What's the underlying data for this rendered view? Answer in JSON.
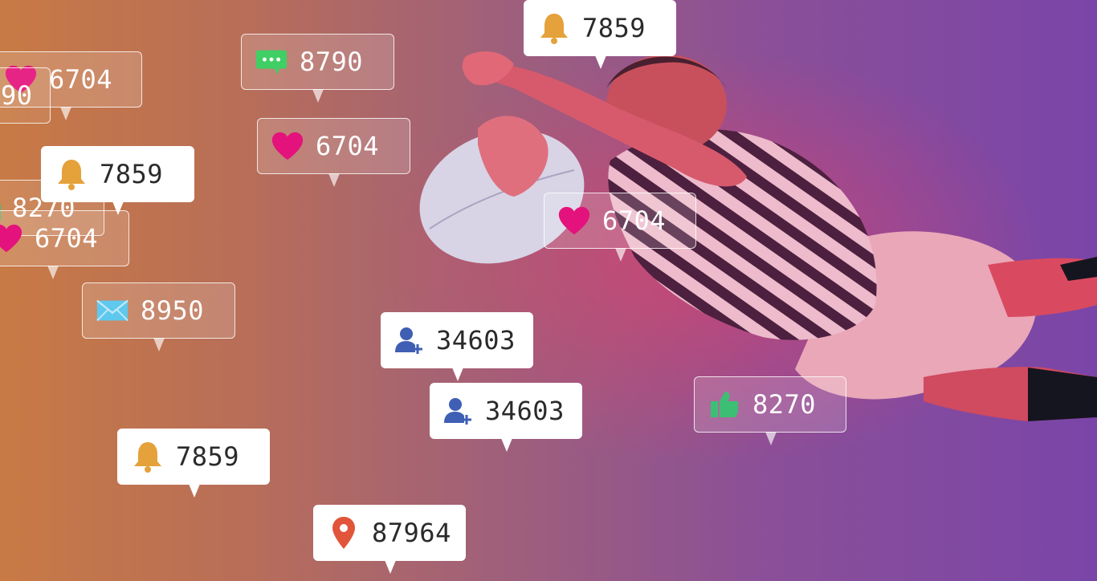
{
  "colors": {
    "heart": "#e4127c",
    "bell": "#e5a13a",
    "comment": "#3fcf65",
    "mail": "#5ec8ee",
    "user": "#3f5fb4",
    "pin": "#e1553a",
    "thumb": "#3cbf74"
  },
  "notifications": [
    {
      "icon": "bell-icon",
      "count": "7859"
    },
    {
      "icon": "comment-icon",
      "count": "8790"
    },
    {
      "icon": "heart-icon",
      "count": "6704"
    },
    {
      "icon": "heart-icon",
      "count": "6704"
    },
    {
      "icon": "bell-icon",
      "count": "7859"
    },
    {
      "icon": "thumbs-up-icon",
      "count": "8270"
    },
    {
      "icon": "heart-icon",
      "count": "6704"
    },
    {
      "icon": "mail-icon",
      "count": "8950"
    },
    {
      "icon": "heart-icon",
      "count": "6704"
    },
    {
      "icon": "add-user-icon",
      "count": "34603"
    },
    {
      "icon": "add-user-icon",
      "count": "34603"
    },
    {
      "icon": "thumbs-up-icon",
      "count": "8270"
    },
    {
      "icon": "bell-icon",
      "count": "7859"
    },
    {
      "icon": "location-pin-icon",
      "count": "87964"
    }
  ],
  "partial_text": [
    "90"
  ]
}
